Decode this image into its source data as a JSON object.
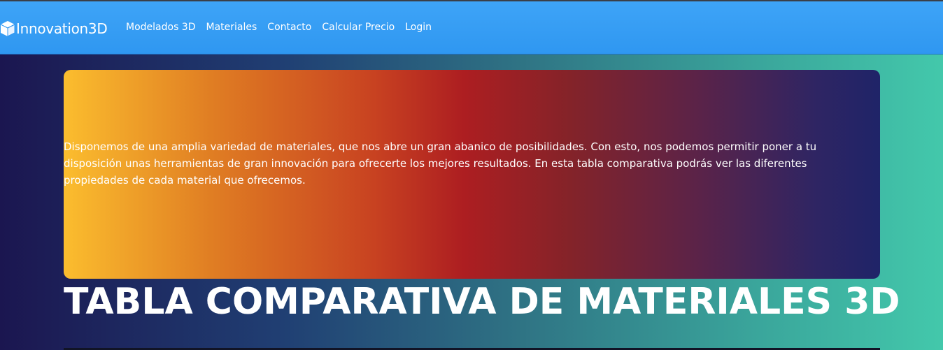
{
  "navbar": {
    "brand": {
      "icon": "cube-icon",
      "text": "Innovation3D"
    },
    "links": [
      {
        "label": "Modelados 3D"
      },
      {
        "label": "Materiales"
      },
      {
        "label": "Contacto"
      },
      {
        "label": "Calcular Precio"
      },
      {
        "label": "Login"
      }
    ]
  },
  "hero": {
    "text": "Disponemos de una amplia variedad de materiales, que nos abre un gran abanico de posibilidades. Con esto, nos podemos permitir poner a tu disposición unas herramientas de gran innovación para ofrecerte los mejores resultados. En esta tabla comparativa podrás ver las diferentes propiedades de cada material que ofrecemos."
  },
  "section": {
    "title": "TABLA COMPARATIVA DE MATERIALES 3D"
  },
  "colors": {
    "navbar": "#3ea4f7",
    "page_gradient_start": "#1b1650",
    "page_gradient_end": "#43c8ab",
    "card_gradient_start": "#fbbd2e",
    "card_gradient_mid": "#ad1e21",
    "card_gradient_end": "#1f2468"
  }
}
